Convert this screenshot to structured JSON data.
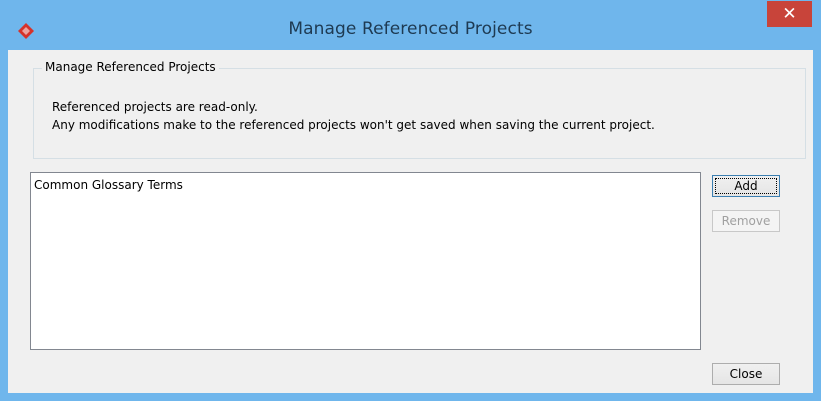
{
  "window": {
    "title": "Manage Referenced Projects",
    "close_glyph": "✕",
    "app_icon": "visual-paradigm-icon"
  },
  "group": {
    "title": "Manage Referenced Projects",
    "lines": [
      "Referenced projects are read-only.",
      "Any modifications make to the referenced projects won't get saved when saving the current project."
    ]
  },
  "projects_list": {
    "items": [
      "Common Glossary Terms"
    ]
  },
  "buttons": {
    "add": "Add",
    "remove": "Remove",
    "close": "Close"
  },
  "colors": {
    "titlebar": "#6fb6ec",
    "close_button": "#c8443a",
    "dialog_bg": "#f0f0f0",
    "icon_red": "#d6322a"
  }
}
